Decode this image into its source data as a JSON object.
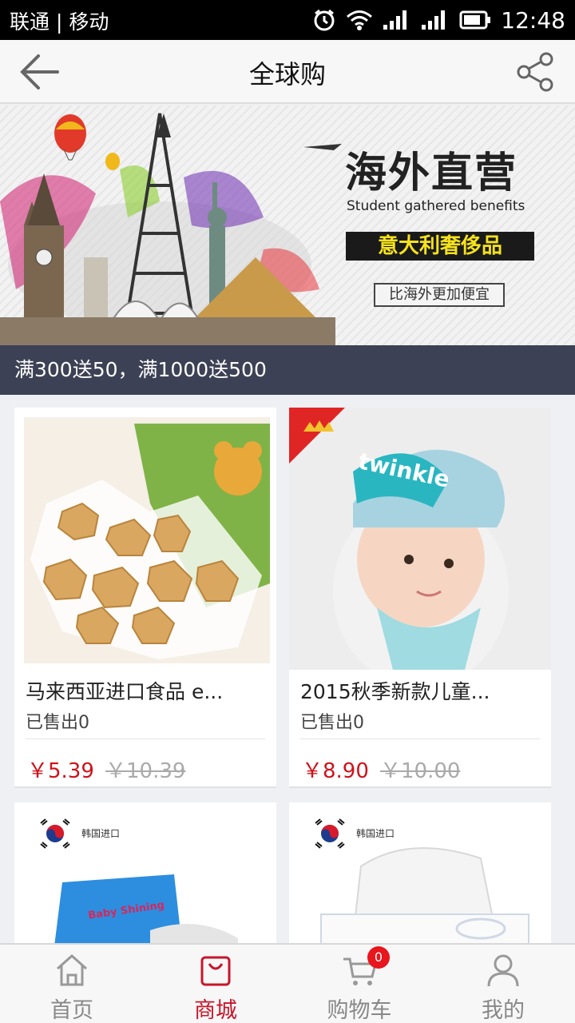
{
  "status_bar": {
    "carrier": "联通 | 移动",
    "time": "12:48"
  },
  "header": {
    "title": "全球购"
  },
  "banner": {
    "title": "海外直营",
    "subtitle": "Student gathered benefits",
    "tag": "意大利奢侈品",
    "button": "比海外更加便宜"
  },
  "promo": {
    "text": "满300送50，满1000送500"
  },
  "products": [
    {
      "name": "马来西亚进口食品 e...",
      "sold": "已售出0",
      "price": "￥5.39",
      "old_price": "￥10.39"
    },
    {
      "name": "2015秋季新款儿童...",
      "sold": "已售出0",
      "price": "￥8.90",
      "old_price": "￥10.00",
      "image_text": "twinkle"
    },
    {
      "origin": "韩国进口",
      "package_text": "Baby Shining"
    },
    {
      "origin": "韩国进口"
    }
  ],
  "tabbar": {
    "tabs": [
      {
        "label": "首页",
        "icon": "home-icon"
      },
      {
        "label": "商城",
        "icon": "shopping-bag-icon",
        "active": true
      },
      {
        "label": "购物车",
        "icon": "cart-icon",
        "badge": "0"
      },
      {
        "label": "我的",
        "icon": "user-icon"
      }
    ]
  },
  "colors": {
    "accent": "#c7162b",
    "price": "#d0121b",
    "promo_bg": "#3d4155"
  }
}
